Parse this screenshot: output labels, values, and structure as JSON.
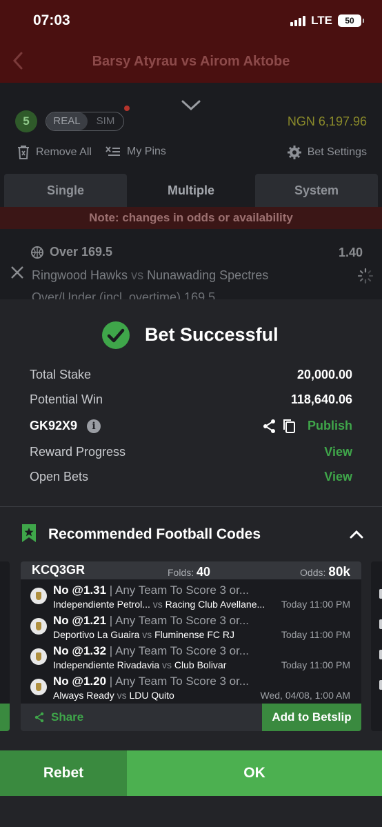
{
  "status_bar": {
    "time": "07:03",
    "network": "LTE",
    "battery": "50"
  },
  "header": {
    "title": "Barsy Atyrau vs Airom Aktobe"
  },
  "betslip": {
    "count": "5",
    "mode_real": "REAL",
    "mode_sim": "SIM",
    "balance": "NGN 6,197.96",
    "remove_all": "Remove All",
    "my_pins": "My Pins",
    "bet_settings": "Bet Settings",
    "tabs": [
      {
        "label": "Single"
      },
      {
        "label": "Multiple"
      },
      {
        "label": "System"
      }
    ],
    "note": "Note: changes in odds or availability",
    "selection": {
      "title": "Over 169.5",
      "odds": "1.40",
      "home": "Ringwood Hawks",
      "vs": "vs",
      "away": "Nunawading Spectres",
      "market": "Over/Under (incl. overtime) 169.5"
    }
  },
  "modal": {
    "title": "Bet Successful",
    "total_stake_label": "Total Stake",
    "total_stake": "20,000.00",
    "potential_win_label": "Potential Win",
    "potential_win": "118,640.06",
    "booking_code": "GK92X9",
    "publish": "Publish",
    "reward_progress_label": "Reward Progress",
    "reward_progress_link": "View",
    "open_bets_label": "Open Bets",
    "open_bets_link": "View",
    "recommended_title": "Recommended Football Codes",
    "code_card": {
      "code": "KCQ3GR",
      "folds_label": "Folds:",
      "folds": "40",
      "odds_label": "Odds:",
      "odds": "80k",
      "picks": [
        {
          "pick": "No @1.31",
          "market": "| Any Team To Score 3 or...",
          "home": "Independiente Petrol...",
          "vs": "vs",
          "away": "Racing Club Avellane...",
          "time": "Today 11:00 PM"
        },
        {
          "pick": "No @1.21",
          "market": "| Any Team To Score 3 or...",
          "home": "Deportivo La Guaira",
          "vs": "vs",
          "away": "Fluminense FC RJ",
          "time": "Today 11:00 PM"
        },
        {
          "pick": "No @1.32",
          "market": "| Any Team To Score 3 or...",
          "home": "Independiente Rivadavia",
          "vs": "vs",
          "away": "Club Bolivar",
          "time": "Today 11:00 PM"
        },
        {
          "pick": "No @1.20",
          "market": "| Any Team To Score 3 or...",
          "home": "Always Ready",
          "vs": "vs",
          "away": "LDU Quito",
          "time": "Wed, 04/08, 1:00 AM"
        }
      ],
      "share": "Share",
      "add_to_betslip": "Add to Betslip"
    },
    "rebet": "Rebet",
    "ok": "OK"
  },
  "colors": {
    "accent_green": "#3fa64a",
    "ok_green": "#4cb050",
    "header_red": "#4a1010"
  },
  "icons": [
    "back-arrow-icon",
    "chevron-down-icon",
    "trash-icon",
    "pin-icon",
    "gear-icon",
    "basketball-icon",
    "close-icon",
    "spinner-icon",
    "check-circle-icon",
    "info-icon",
    "share-icon",
    "copy-icon",
    "bookmark-star-icon",
    "chevron-up-icon",
    "team-logo-icon"
  ]
}
